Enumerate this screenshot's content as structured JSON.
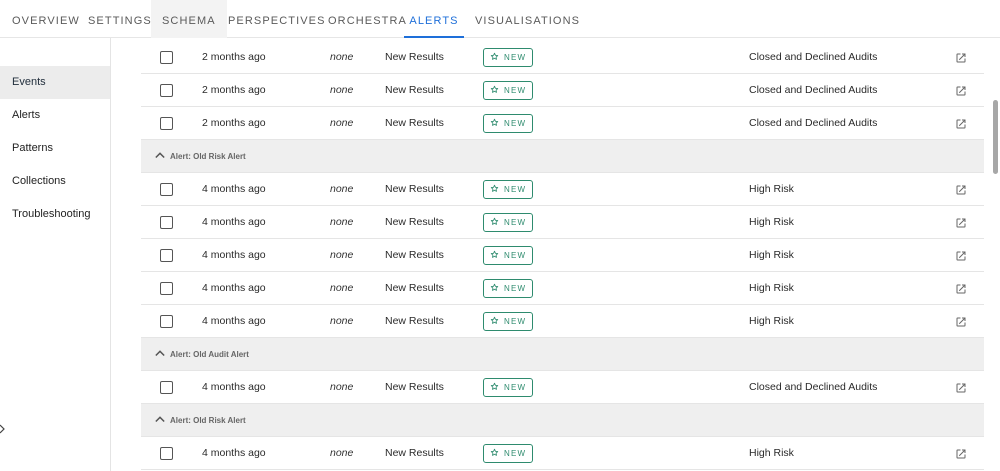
{
  "tabs": [
    {
      "label": "OVERVIEW"
    },
    {
      "label": "SETTINGS"
    },
    {
      "label": "SCHEMA"
    },
    {
      "label": "PERSPECTIVES"
    },
    {
      "label": "ORCHESTRA"
    },
    {
      "label": "ALERTS"
    },
    {
      "label": "VISUALISATIONS"
    }
  ],
  "active_tab": "ALERTS",
  "sidebar": {
    "items": [
      {
        "label": "Events"
      },
      {
        "label": "Alerts"
      },
      {
        "label": "Patterns"
      },
      {
        "label": "Collections"
      },
      {
        "label": "Troubleshooting"
      }
    ],
    "active": "Events"
  },
  "badge_label": "NEW",
  "rows": [
    {
      "kind": "event",
      "date": "2 months ago",
      "assignee": "none",
      "status": "New Results",
      "badge": "NEW",
      "type": "Closed and Declined Audits"
    },
    {
      "kind": "event",
      "date": "2 months ago",
      "assignee": "none",
      "status": "New Results",
      "badge": "NEW",
      "type": "Closed and Declined Audits"
    },
    {
      "kind": "event",
      "date": "2 months ago",
      "assignee": "none",
      "status": "New Results",
      "badge": "NEW",
      "type": "Closed and Declined Audits"
    },
    {
      "kind": "group",
      "label": "Alert: Old Risk Alert"
    },
    {
      "kind": "event",
      "date": "4 months ago",
      "assignee": "none",
      "status": "New Results",
      "badge": "NEW",
      "type": "High Risk"
    },
    {
      "kind": "event",
      "date": "4 months ago",
      "assignee": "none",
      "status": "New Results",
      "badge": "NEW",
      "type": "High Risk"
    },
    {
      "kind": "event",
      "date": "4 months ago",
      "assignee": "none",
      "status": "New Results",
      "badge": "NEW",
      "type": "High Risk"
    },
    {
      "kind": "event",
      "date": "4 months ago",
      "assignee": "none",
      "status": "New Results",
      "badge": "NEW",
      "type": "High Risk"
    },
    {
      "kind": "event",
      "date": "4 months ago",
      "assignee": "none",
      "status": "New Results",
      "badge": "NEW",
      "type": "High Risk"
    },
    {
      "kind": "group",
      "label": "Alert: Old Audit Alert"
    },
    {
      "kind": "event",
      "date": "4 months ago",
      "assignee": "none",
      "status": "New Results",
      "badge": "NEW",
      "type": "Closed and Declined Audits"
    },
    {
      "kind": "group",
      "label": "Alert: Old Risk Alert"
    },
    {
      "kind": "event",
      "date": "4 months ago",
      "assignee": "none",
      "status": "New Results",
      "badge": "NEW",
      "type": "High Risk"
    }
  ],
  "colors": {
    "accent": "#1e6fd9",
    "badge": "#2e8b6e",
    "group_bg": "#efefef",
    "sidebar_active_bg": "#ececec"
  },
  "icons": {
    "row_checkbox": "checkbox-icon",
    "badge_star": "star-outline-icon",
    "open_link": "open-in-new-icon",
    "group_toggle": "chevron-up-icon"
  }
}
